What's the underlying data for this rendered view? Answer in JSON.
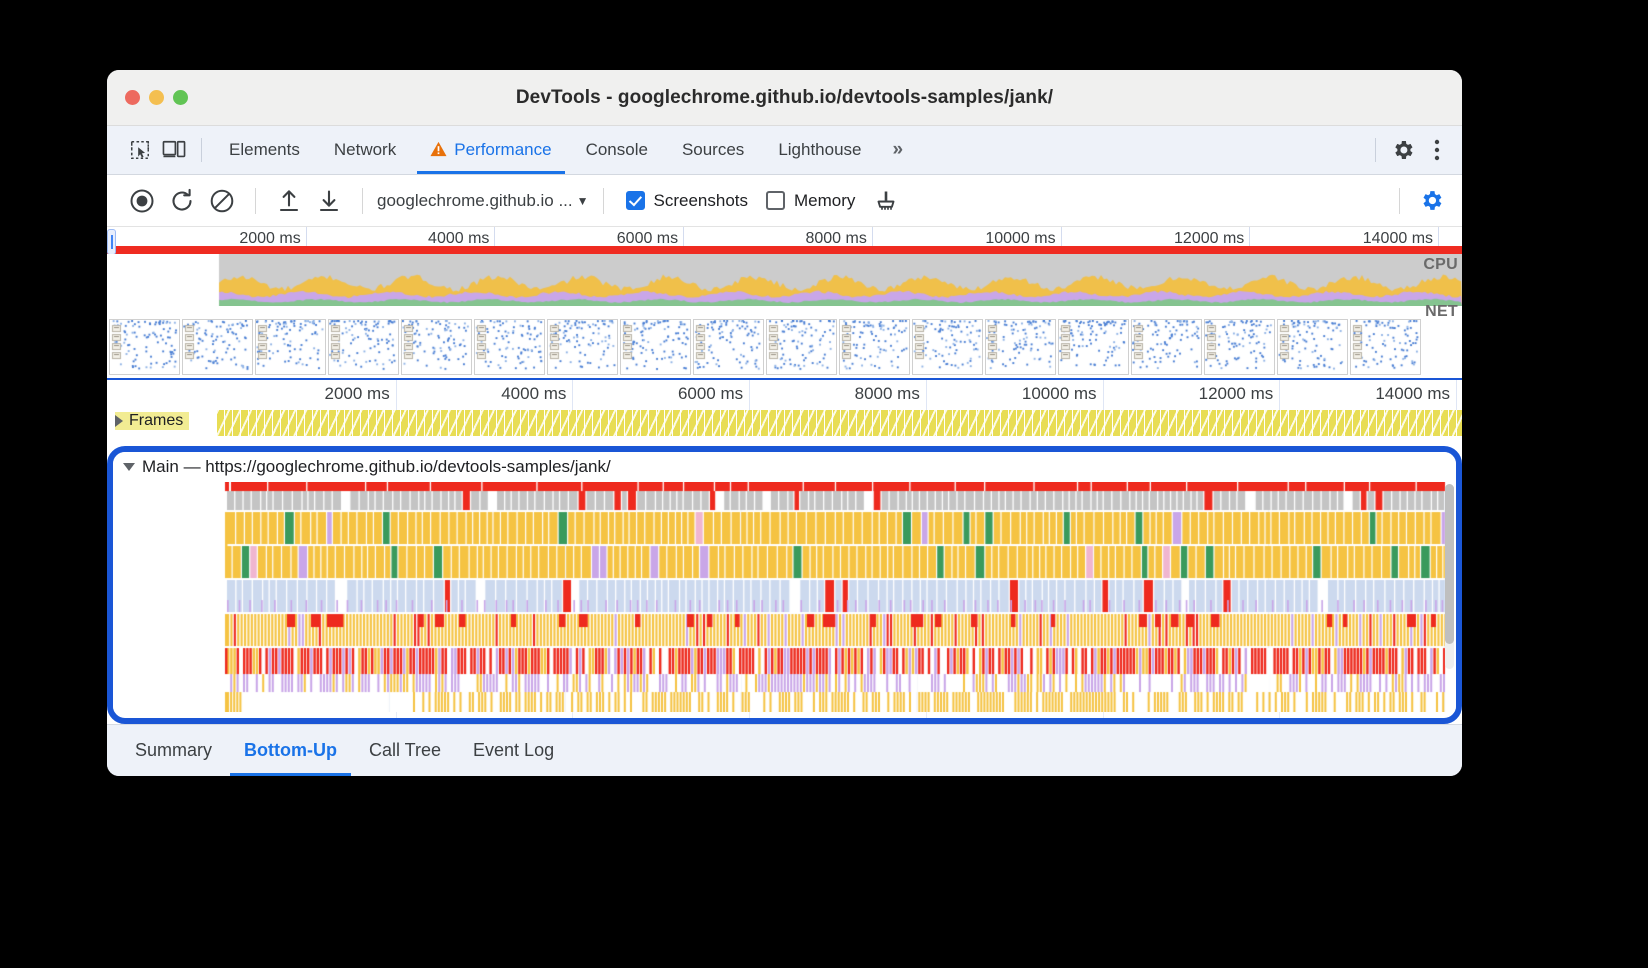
{
  "window": {
    "title": "DevTools - googlechrome.github.io/devtools-samples/jank/",
    "traffic_lights": [
      "close",
      "minimize",
      "maximize"
    ]
  },
  "tabstrip": {
    "icons": [
      "inspect-element-icon",
      "device-toolbar-icon"
    ],
    "tabs": [
      {
        "label": "Elements",
        "active": false,
        "warning": false
      },
      {
        "label": "Network",
        "active": false,
        "warning": false
      },
      {
        "label": "Performance",
        "active": true,
        "warning": true
      },
      {
        "label": "Console",
        "active": false,
        "warning": false
      },
      {
        "label": "Sources",
        "active": false,
        "warning": false
      },
      {
        "label": "Lighthouse",
        "active": false,
        "warning": false
      }
    ],
    "overflow_label": "»",
    "right_icons": [
      "settings-gear-icon",
      "more-options-icon"
    ]
  },
  "perf_toolbar": {
    "record_icon": "record-icon",
    "reload_icon": "reload-and-record-icon",
    "clear_icon": "clear-recording-icon",
    "upload_icon": "load-profile-icon",
    "download_icon": "save-profile-icon",
    "target_select": "googlechrome.github.io ...",
    "screenshots": {
      "label": "Screenshots",
      "checked": true
    },
    "memory": {
      "label": "Memory",
      "checked": false
    },
    "gc_icon": "collect-garbage-icon",
    "settings_icon": "capture-settings-icon",
    "accent": "#1a73e8"
  },
  "overview": {
    "ticks": [
      "2000 ms",
      "4000 ms",
      "6000 ms",
      "8000 ms",
      "10000 ms",
      "12000 ms",
      "14000 ms"
    ],
    "cpu_label": "CPU",
    "net_label": "NET",
    "error_bar_color": "#ef2b21",
    "cpu_colors": {
      "scripting": "#f0c04a",
      "rendering": "#c9a6e8",
      "painting": "#85c490",
      "idle": "#cccccc"
    }
  },
  "timeline": {
    "ticks": [
      "2000 ms",
      "4000 ms",
      "6000 ms",
      "8000 ms",
      "10000 ms",
      "12000 ms",
      "14000 ms"
    ],
    "frames_track": {
      "label": "Frames",
      "expanded": false
    },
    "main_track": {
      "label": "Main — https://googlechrome.github.io/devtools-samples/jank/",
      "expanded": true,
      "highlight_color": "#1a56d6"
    }
  },
  "bottom_tabs": [
    {
      "label": "Summary",
      "active": false
    },
    {
      "label": "Bottom-Up",
      "active": true
    },
    {
      "label": "Call Tree",
      "active": false
    },
    {
      "label": "Event Log",
      "active": false
    }
  ]
}
